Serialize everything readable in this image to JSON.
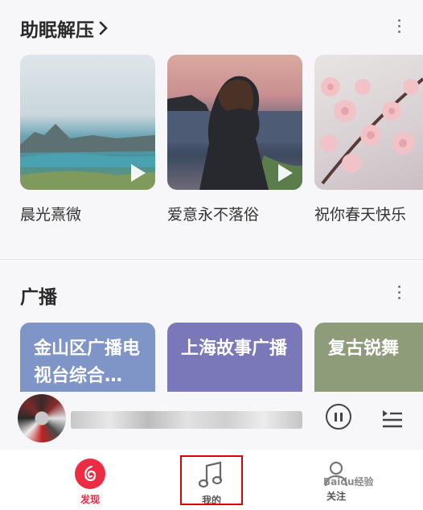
{
  "sections": {
    "relax": {
      "title": "助眠解压",
      "cards": [
        {
          "label": "晨光熹微"
        },
        {
          "label": "爱意永不落俗"
        },
        {
          "label": "祝你春天快乐"
        }
      ]
    },
    "radio": {
      "title": "广播",
      "cards": [
        {
          "label": "金山区广播电视台综合…",
          "color": "#7f95c8"
        },
        {
          "label": "上海故事广播",
          "color": "#7a78b8"
        },
        {
          "label": "复古锐舞",
          "color": "#8e9c7a"
        }
      ]
    }
  },
  "player": {
    "icons": [
      "pause-icon",
      "playlist-icon"
    ]
  },
  "tabbar": {
    "tabs": [
      {
        "label": "发现",
        "icon": "discover-icon",
        "active": true,
        "color": "#ec2c43"
      },
      {
        "label": "我的",
        "icon": "music-note-icon",
        "active": false
      },
      {
        "label": "关注",
        "icon": "person-icon",
        "active": false
      }
    ]
  },
  "watermark": {
    "text": "Baidu经验"
  }
}
